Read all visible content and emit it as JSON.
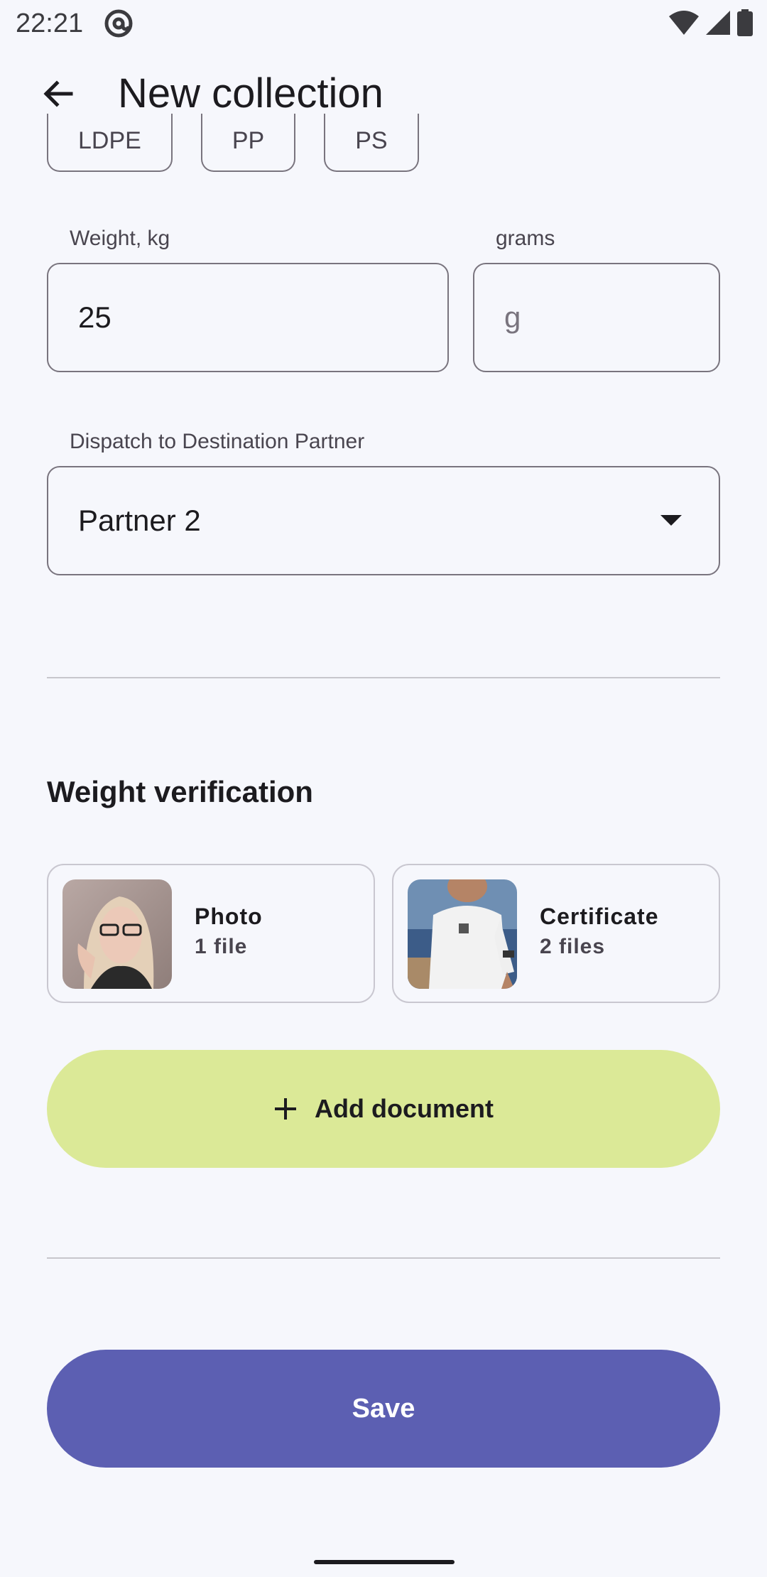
{
  "status_bar": {
    "time": "22:21"
  },
  "app_bar": {
    "title": "New collection",
    "back_icon": "arrow-back-icon"
  },
  "plastic_chips": [
    "LDPE",
    "PP",
    "PS"
  ],
  "weight": {
    "kg_label": "Weight, kg",
    "kg_value": "25",
    "grams_label": "grams",
    "grams_placeholder": "g"
  },
  "dispatch": {
    "label": "Dispatch to Destination Partner",
    "selected": "Partner 2"
  },
  "verification": {
    "title": "Weight verification",
    "documents": [
      {
        "name": "Photo",
        "count": "1 file"
      },
      {
        "name": "Certificate",
        "count": "2 files"
      }
    ],
    "add_label": "Add document"
  },
  "save_label": "Save",
  "colors": {
    "background": "#f6f7fc",
    "add_button": "#dbe997",
    "save_button": "#5c5fb2"
  }
}
